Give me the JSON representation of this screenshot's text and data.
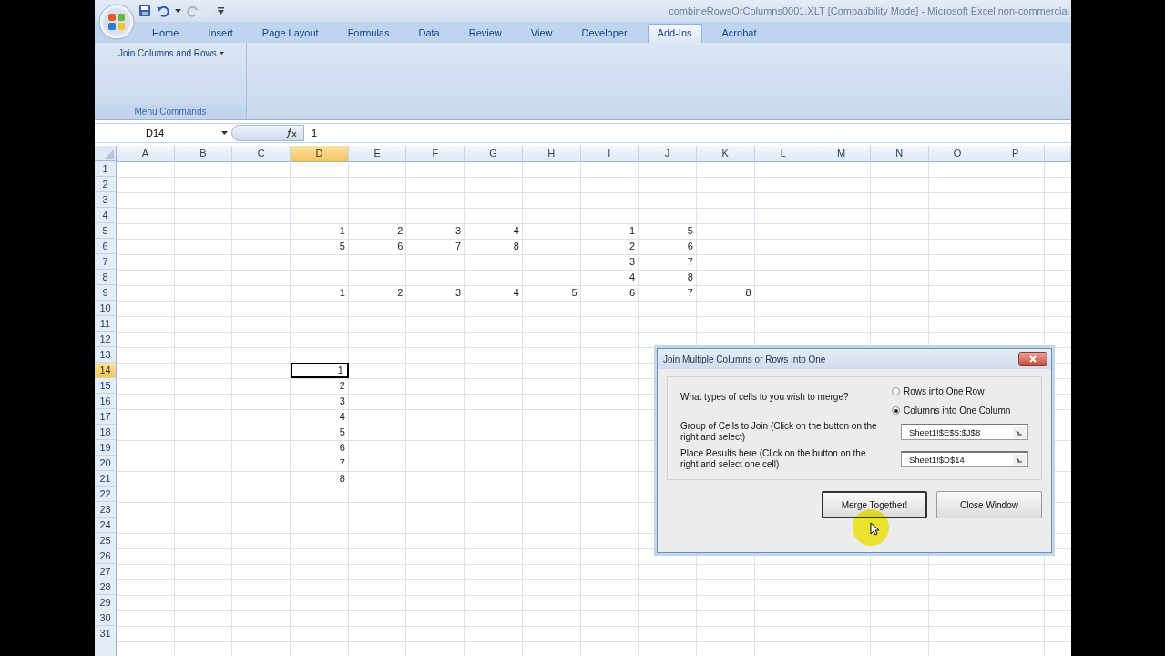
{
  "window": {
    "title": "combineRowsOrColumns0001.XLT  [Compatibility Mode] - Microsoft Excel non-commercial"
  },
  "tabs": [
    {
      "label": "Home",
      "selected": false
    },
    {
      "label": "Insert",
      "selected": false
    },
    {
      "label": "Page Layout",
      "selected": false
    },
    {
      "label": "Formulas",
      "selected": false
    },
    {
      "label": "Data",
      "selected": false
    },
    {
      "label": "Review",
      "selected": false
    },
    {
      "label": "View",
      "selected": false
    },
    {
      "label": "Developer",
      "selected": false
    },
    {
      "label": "Add-Ins",
      "selected": true
    },
    {
      "label": "Acrobat",
      "selected": false
    }
  ],
  "ribbon": {
    "button": "Join Columns and Rows",
    "group_label": "Menu Commands"
  },
  "formula_bar": {
    "name_box": "D14",
    "formula": "1"
  },
  "sheet": {
    "columns": [
      {
        "label": "A",
        "selected": false
      },
      {
        "label": "B",
        "selected": false
      },
      {
        "label": "C",
        "selected": false
      },
      {
        "label": "D",
        "selected": true
      },
      {
        "label": "E",
        "selected": false
      },
      {
        "label": "F",
        "selected": false
      },
      {
        "label": "G",
        "selected": false
      },
      {
        "label": "H",
        "selected": false
      },
      {
        "label": "I",
        "selected": false
      },
      {
        "label": "J",
        "selected": false
      },
      {
        "label": "K",
        "selected": false
      },
      {
        "label": "L",
        "selected": false
      },
      {
        "label": "M",
        "selected": false
      },
      {
        "label": "N",
        "selected": false
      },
      {
        "label": "O",
        "selected": false
      },
      {
        "label": "P",
        "selected": false
      }
    ],
    "rows": [
      {
        "label": "1",
        "selected": false
      },
      {
        "label": "2",
        "selected": false
      },
      {
        "label": "3",
        "selected": false
      },
      {
        "label": "4",
        "selected": false
      },
      {
        "label": "5",
        "selected": false,
        "cells": {
          "D": "1",
          "E": "2",
          "F": "3",
          "G": "4",
          "I": "1",
          "J": "5"
        }
      },
      {
        "label": "6",
        "selected": false,
        "cells": {
          "D": "5",
          "E": "6",
          "F": "7",
          "G": "8",
          "I": "2",
          "J": "6"
        }
      },
      {
        "label": "7",
        "selected": false,
        "cells": {
          "I": "3",
          "J": "7"
        }
      },
      {
        "label": "8",
        "selected": false,
        "cells": {
          "I": "4",
          "J": "8"
        }
      },
      {
        "label": "9",
        "selected": false,
        "cells": {
          "D": "1",
          "E": "2",
          "F": "3",
          "G": "4",
          "H": "5",
          "I": "6",
          "J": "7",
          "K": "8"
        }
      },
      {
        "label": "10",
        "selected": false
      },
      {
        "label": "11",
        "selected": false
      },
      {
        "label": "12",
        "selected": false
      },
      {
        "label": "13",
        "selected": false
      },
      {
        "label": "14",
        "selected": true,
        "cells": {
          "D": "1"
        }
      },
      {
        "label": "15",
        "selected": false,
        "cells": {
          "D": "2"
        }
      },
      {
        "label": "16",
        "selected": false,
        "cells": {
          "D": "3"
        }
      },
      {
        "label": "17",
        "selected": false,
        "cells": {
          "D": "4"
        }
      },
      {
        "label": "18",
        "selected": false,
        "cells": {
          "D": "5"
        }
      },
      {
        "label": "19",
        "selected": false,
        "cells": {
          "D": "6"
        }
      },
      {
        "label": "20",
        "selected": false,
        "cells": {
          "D": "7"
        }
      },
      {
        "label": "21",
        "selected": false,
        "cells": {
          "D": "8"
        }
      },
      {
        "label": "22",
        "selected": false
      },
      {
        "label": "23",
        "selected": false
      },
      {
        "label": "24",
        "selected": false
      },
      {
        "label": "25",
        "selected": false
      },
      {
        "label": "26",
        "selected": false
      },
      {
        "label": "27",
        "selected": false
      },
      {
        "label": "28",
        "selected": false
      },
      {
        "label": "29",
        "selected": false
      },
      {
        "label": "30",
        "selected": false
      },
      {
        "label": "31",
        "selected": false
      }
    ]
  },
  "dialog": {
    "title": "Join Multiple Columns or Rows Into One",
    "question": "What types of cells to you wish to merge?",
    "options": [
      {
        "label": "Rows into One Row",
        "selected": false
      },
      {
        "label": "Columns into One Column",
        "selected": true
      }
    ],
    "fields": [
      {
        "label": "Group of Cells to Join (Click on the button on the right and select)",
        "value": "Sheet1!$E$5:$J$8"
      },
      {
        "label": "Place Results here (Click on the button on the right and select one cell)",
        "value": "Sheet1!$D$14"
      }
    ],
    "buttons": [
      {
        "label": "Merge Together!",
        "focused": true
      },
      {
        "label": "Close Window",
        "focused": false
      }
    ]
  }
}
